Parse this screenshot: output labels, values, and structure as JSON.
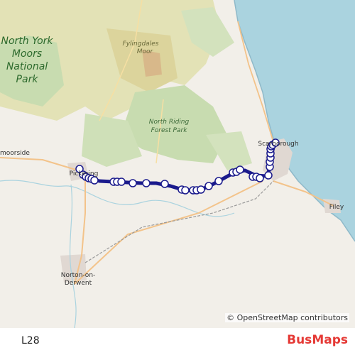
{
  "map": {
    "attribution_symbol": "©",
    "attribution": "OpenStreetMap contributors",
    "labels": {
      "park": [
        "North York",
        "Moors",
        "National",
        "Park"
      ],
      "fylingdales": [
        "Fylingdales",
        "Moor"
      ],
      "forest": [
        "North Riding",
        "Forest Park"
      ],
      "scarborough": "Scarborough",
      "pickering": "Pickering",
      "kirkbymoorside": "moorside",
      "filey": "Filey",
      "norton": [
        "Norton-on-",
        "Derwent"
      ]
    },
    "colors": {
      "sea": "#aad3df",
      "land": "#f2efe9",
      "moor": "#e3e2b6",
      "forest": "#c8dcb0",
      "route": "#1a1a8c"
    }
  },
  "footer": {
    "route_name": "L28",
    "brand_bus": "Bus",
    "brand_maps": "Maps"
  }
}
